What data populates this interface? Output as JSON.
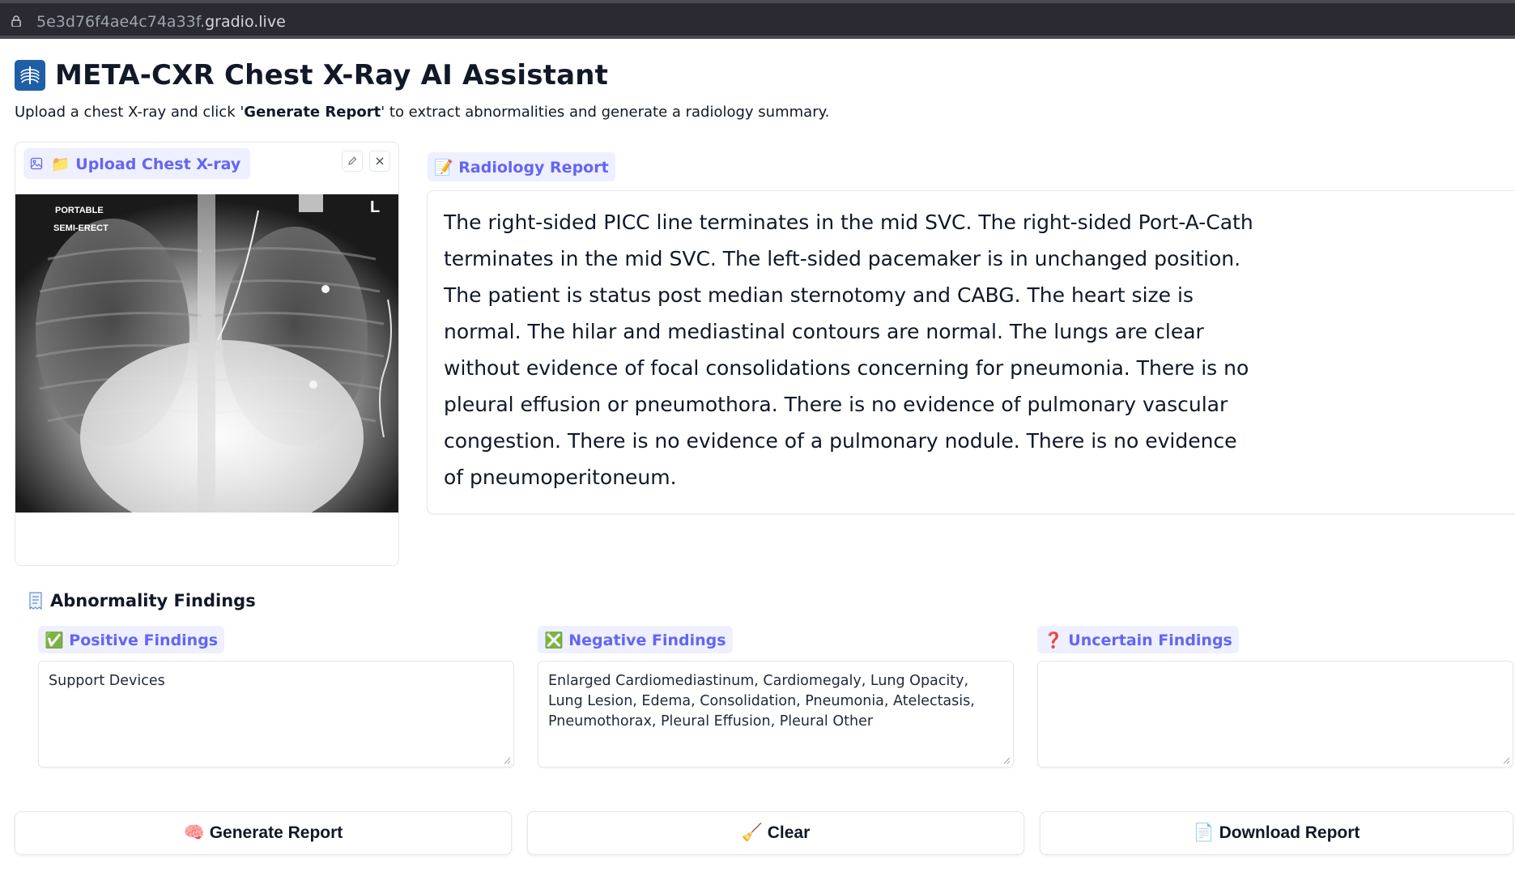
{
  "browser": {
    "url_prefix": "5e3d76f4ae4c74a33f.",
    "url_domain": "gradio.live",
    "lock_icon": "lock-icon"
  },
  "header": {
    "icon": "xray-icon",
    "title": "META-CXR Chest X-Ray AI Assistant",
    "subtitle_pre": "Upload a chest X-ray and click '",
    "subtitle_bold": "Generate Report",
    "subtitle_post": "' to extract abnormalities and generate a radiology summary."
  },
  "upload": {
    "label": "📁 Upload Chest X-ray",
    "image_marker_top": "PORTABLE",
    "image_marker_bottom": "SEMI-ERECT",
    "side_marker": "L"
  },
  "report": {
    "label": "📝 Radiology Report",
    "text": "The right-sided PICC line terminates in the mid SVC. The right-sided Port-A-Cath terminates in the mid SVC. The left-sided pacemaker is in unchanged position. The patient is status post median sternotomy and CABG. The heart size is normal. The hilar and mediastinal contours are normal. The lungs are clear without evidence of focal consolidations concerning for pneumonia. There is no pleural effusion or pneumothora. There is no evidence of pulmonary vascular congestion. There is no evidence of a pulmonary nodule. There is no evidence of pneumoperitoneum."
  },
  "findings": {
    "heading": "Abnormality Findings",
    "positive": {
      "label": "✅ Positive Findings",
      "value": "Support Devices"
    },
    "negative": {
      "label": "❎ Negative Findings",
      "value": "Enlarged Cardiomediastinum, Cardiomegaly, Lung Opacity, Lung Lesion, Edema, Consolidation, Pneumonia, Atelectasis, Pneumothorax, Pleural Effusion, Pleural Other"
    },
    "uncertain": {
      "label": "❓ Uncertain Findings",
      "value": ""
    }
  },
  "buttons": {
    "generate": "🧠 Generate Report",
    "clear": "🧹 Clear",
    "download": "📄 Download Report"
  },
  "colors": {
    "accent": "#6366f1",
    "label_bg": "#eef0ff",
    "url_bar": "#2b2a33"
  }
}
